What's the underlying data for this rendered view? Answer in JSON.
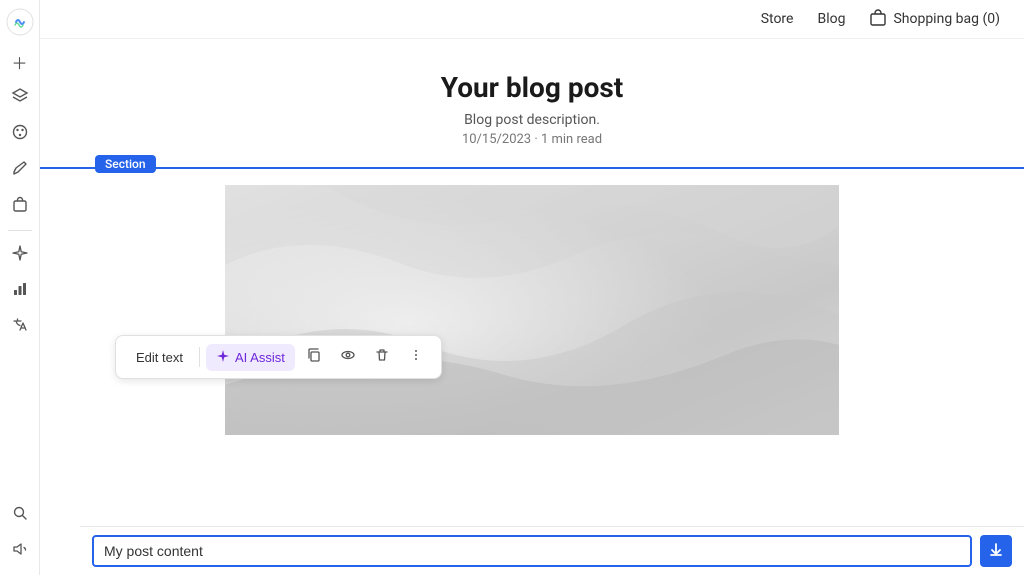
{
  "sidebar": {
    "logo_icon": "wix-logo",
    "items": [
      {
        "icon": "plus-icon",
        "label": "Add"
      },
      {
        "icon": "layers-icon",
        "label": "Layers"
      },
      {
        "icon": "palette-icon",
        "label": "Design"
      },
      {
        "icon": "pen-icon",
        "label": "Edit"
      },
      {
        "icon": "bag-icon",
        "label": "Store"
      },
      {
        "icon": "sparkle-icon",
        "label": "AI"
      },
      {
        "icon": "chart-icon",
        "label": "Analytics"
      },
      {
        "icon": "translate-icon",
        "label": "Multilingual"
      }
    ],
    "bottom_items": [
      {
        "icon": "search-icon",
        "label": "Search"
      },
      {
        "icon": "announcement-icon",
        "label": "Announcements"
      }
    ]
  },
  "nav": {
    "links": [
      "Store",
      "Blog"
    ],
    "cart_label": "Shopping bag (0)"
  },
  "blog": {
    "title": "Your blog post",
    "description": "Blog post description.",
    "meta": "10/15/2023 · 1 min read"
  },
  "section": {
    "label": "Section"
  },
  "toolbar": {
    "edit_text_label": "Edit text",
    "ai_assist_label": "AI Assist",
    "copy_icon": "copy-icon",
    "visibility_icon": "eye-icon",
    "delete_icon": "trash-icon",
    "more_icon": "more-icon"
  },
  "bottom_bar": {
    "input_value": "My post content",
    "download_icon": "download-icon"
  }
}
